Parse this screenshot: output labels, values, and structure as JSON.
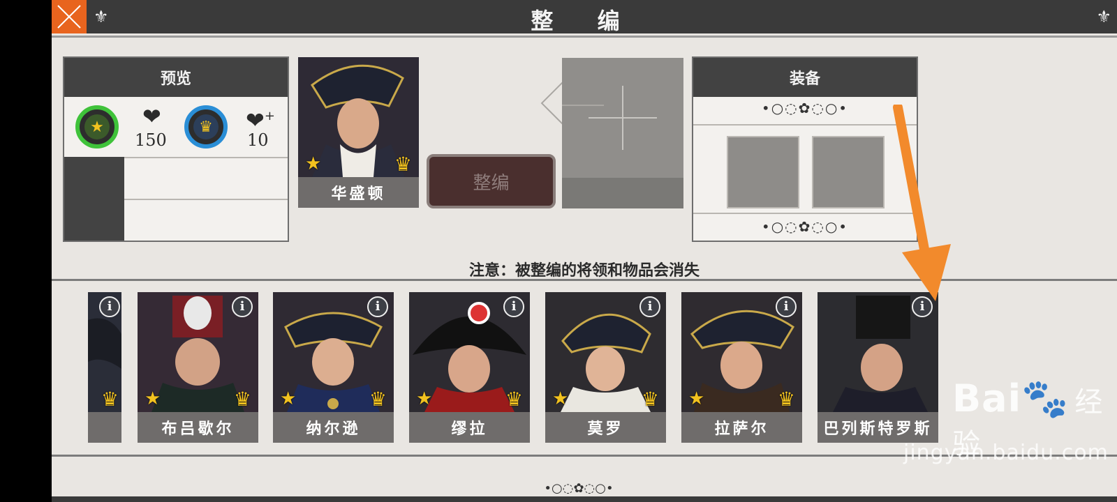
{
  "header": {
    "title": "整 编"
  },
  "preview": {
    "title": "预览",
    "health_value": "150",
    "health_bonus_value": "10"
  },
  "selected_general": {
    "name": "华盛顿"
  },
  "merge_button": {
    "label": "整编"
  },
  "equipment": {
    "title": "装备"
  },
  "notice": "注意：被整编的将领和物品会消失",
  "generals": [
    {
      "name": "布吕歇尔"
    },
    {
      "name": "纳尔逊"
    },
    {
      "name": "缪拉"
    },
    {
      "name": "莫罗"
    },
    {
      "name": "拉萨尔"
    },
    {
      "name": "巴列斯特罗斯"
    }
  ],
  "watermark": {
    "logo": "Bai",
    "brand": "经验",
    "url": "jingyan.baidu.com"
  },
  "colors": {
    "accent_orange": "#e8641e",
    "bar_dark": "#3a3a3a",
    "rank_gold": "#f2c21f"
  },
  "icons": [
    "close-icon",
    "fleur-de-lis-icon",
    "star-icon",
    "crown-icon",
    "heart-icon",
    "heart-plus-icon",
    "info-icon",
    "ornament-icon",
    "arrow-left-icon",
    "plus-icon"
  ]
}
